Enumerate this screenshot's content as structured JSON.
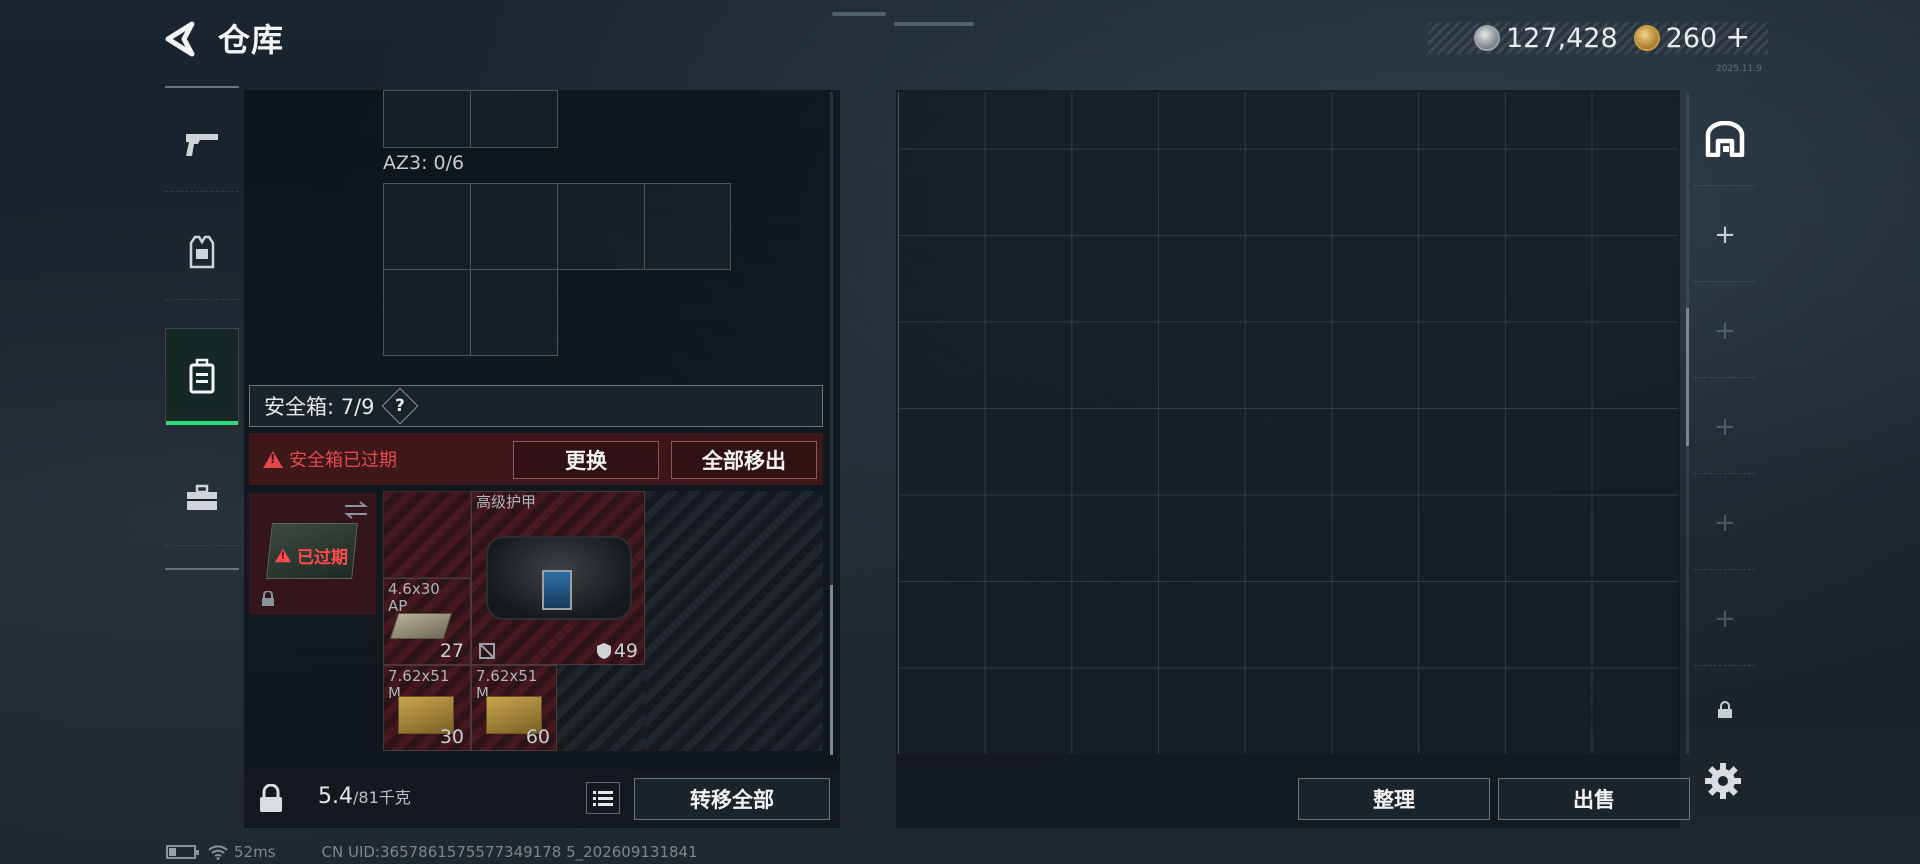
{
  "header": {
    "title": "仓库",
    "currency": [
      {
        "icon": "silver-coin-icon",
        "value": "127,428"
      },
      {
        "icon": "gold-coin-icon",
        "value": "260"
      }
    ],
    "add_label": "+",
    "version_tag": "2025.11.9"
  },
  "left_tabs": [
    {
      "icon": "gun-icon",
      "active": false
    },
    {
      "icon": "vest-icon",
      "active": false
    },
    {
      "icon": "backpack-icon",
      "active": true
    },
    {
      "icon": "toolbox-icon",
      "active": false
    }
  ],
  "inventory": {
    "az3_label": "AZ3: 0/6",
    "safebox_label": "安全箱: 7/9",
    "help_label": "?",
    "expired_notice": "安全箱已过期",
    "replace_button": "更换",
    "remove_all_button": "全部移出",
    "secure_status": "已过期",
    "items": [
      {
        "name": "4.6x30\nAP",
        "count": "27"
      },
      {
        "name": "高级护甲",
        "durability": "49"
      },
      {
        "name": "7.62x51\nM",
        "count": "30"
      },
      {
        "name": "7.62x51\nM",
        "count": "60"
      }
    ],
    "weight_current": "5.4",
    "weight_capacity": "/81千克",
    "transfer_all_button": "转移全部"
  },
  "storage": {
    "sort_button": "整理",
    "sell_button": "出售",
    "tabs": [
      {
        "icon": "warehouse-icon"
      },
      {
        "icon": "plus-icon",
        "label": "+"
      },
      {
        "icon": "plus-icon",
        "label": "+"
      },
      {
        "icon": "plus-icon",
        "label": "+"
      },
      {
        "icon": "plus-icon",
        "label": "+"
      },
      {
        "icon": "plus-icon",
        "label": "+"
      },
      {
        "icon": "lock-icon"
      }
    ]
  },
  "footer": {
    "ping": "52ms",
    "uid": "CN UID:3657861575577349178 5_202609131841"
  },
  "colors": {
    "accent_green": "#2fd97c",
    "warning_red": "#e24a4a"
  }
}
